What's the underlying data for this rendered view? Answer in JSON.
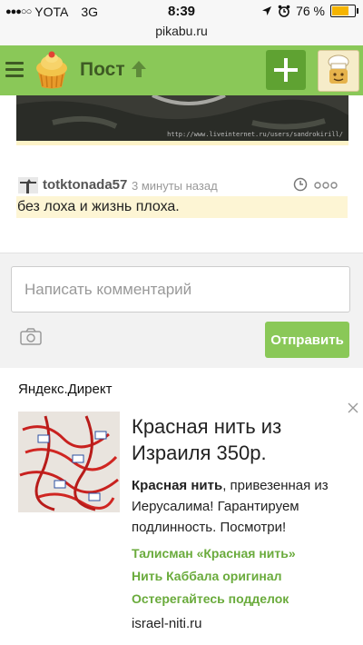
{
  "status_bar": {
    "signal_dots": "●●●○○",
    "carrier": "YOTA",
    "network": "3G",
    "time": "8:39",
    "battery_percent": "76 %",
    "battery_level": 0.76,
    "url": "pikabu.ru"
  },
  "navbar": {
    "title": "Пост",
    "menu_icon": "hamburger-icon",
    "add_icon": "plus-icon",
    "accent_color": "#8ac858"
  },
  "post": {
    "image_watermark": "http://www.liveinternet.ru/users/sandrokirill/"
  },
  "comment": {
    "username": "totktonada57",
    "time": "3 минуты назад",
    "text": "без лоха и жизнь плоха."
  },
  "reply": {
    "placeholder": "Написать комментарий",
    "send_label": "Отправить"
  },
  "ad": {
    "source": "Яндекс.Директ",
    "title": "Красная нить из Израиля 350р.",
    "body_bold": "Красная нить",
    "body_rest": ", привезенная из Иерусалима! Гарантируем подлинность. Посмотри!",
    "links": [
      "Талисман «Красная нить»",
      "Нить Каббала оригинал",
      "Остерегайтесь подделок"
    ],
    "domain": "israel-niti.ru"
  }
}
